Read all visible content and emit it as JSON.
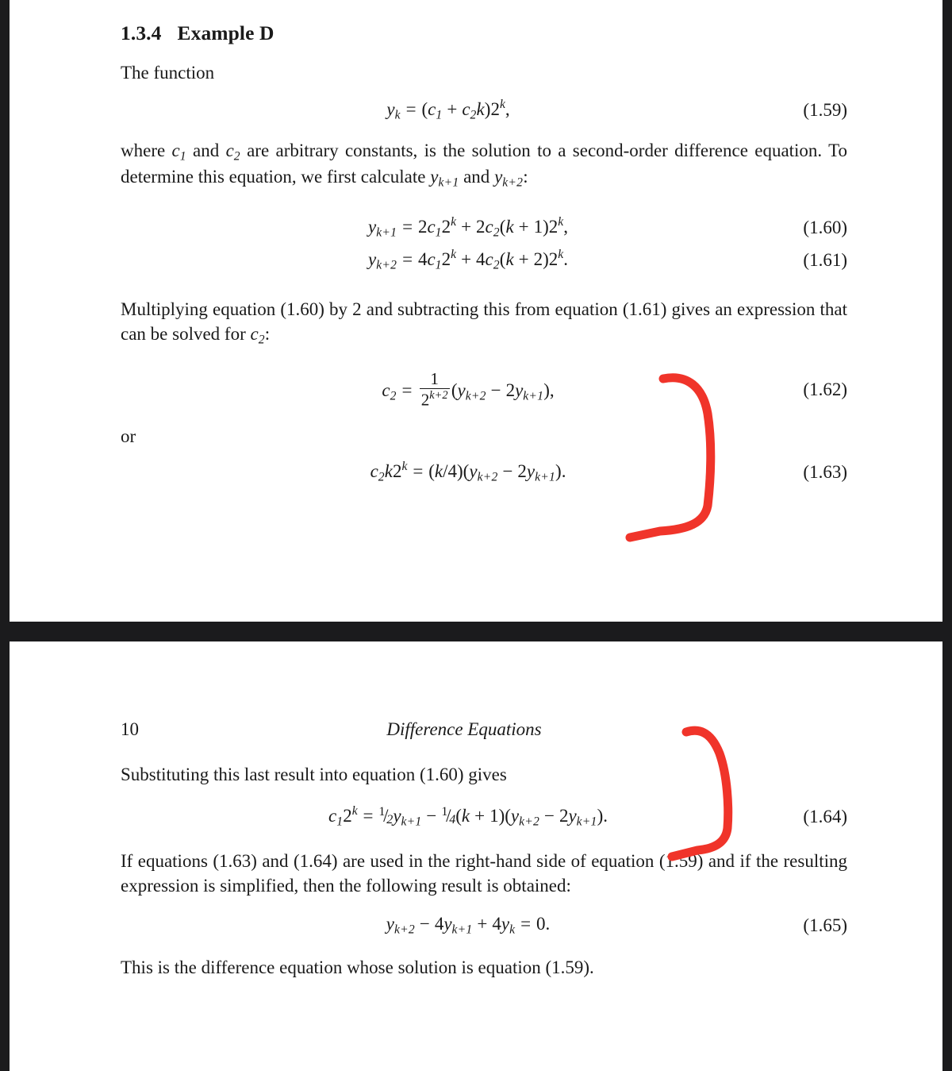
{
  "document": {
    "background_color": "#1b1b1d",
    "page_color": "#ffffff",
    "annotation_color": "#f0342a"
  },
  "page_top": {
    "heading": {
      "number": "1.3.4",
      "title": "Example D"
    },
    "intro": "The function",
    "equation_1_59": {
      "lhs_var": "y",
      "lhs_sub": "k",
      "eq": "=",
      "open": "(",
      "c1": "c",
      "c1_sub": "1",
      "plus": "+",
      "c2": "c",
      "c2_sub": "2",
      "k": "k",
      "close": ")",
      "two": "2",
      "exp": "k",
      "comma": ",",
      "number": "(1.59)"
    },
    "paragraph_1": {
      "part1": "where ",
      "c1": "c",
      "c1_sub": "1",
      "part2": " and ",
      "c2": "c",
      "c2_sub": "2",
      "part3": " are arbitrary constants, is the solution to a second-order difference equation. To determine this equation, we first calculate ",
      "y1": "y",
      "y1_sub": "k+1",
      "part4": " and ",
      "y2": "y",
      "y2_sub": "k+2",
      "part5": ":"
    },
    "equation_1_60": {
      "lhs": "y",
      "lhs_sub": "k+1",
      "eq": "=",
      "t1_coef": "2",
      "t1_c": "c",
      "t1_c_sub": "1",
      "t1_two": "2",
      "t1_exp": "k",
      "plus": "+",
      "t2_coef": "2",
      "t2_c": "c",
      "t2_c_sub": "2",
      "t2_open": "(",
      "t2_k": "k",
      "t2_plus": "+",
      "t2_one": "1",
      "t2_close": ")",
      "t2_two": "2",
      "t2_exp": "k",
      "end": ",",
      "number": "(1.60)"
    },
    "equation_1_61": {
      "lhs": "y",
      "lhs_sub": "k+2",
      "eq": "=",
      "t1_coef": "4",
      "t1_c": "c",
      "t1_c_sub": "1",
      "t1_two": "2",
      "t1_exp": "k",
      "plus": "+",
      "t2_coef": "4",
      "t2_c": "c",
      "t2_c_sub": "2",
      "t2_open": "(",
      "t2_k": "k",
      "t2_plus": "+",
      "t2_one": "2",
      "t2_close": ")",
      "t2_two": "2",
      "t2_exp": "k",
      "end": ".",
      "number": "(1.61)"
    },
    "paragraph_2": {
      "part1": "Multiplying equation (1.60) by 2 and subtracting this from equation (1.61) gives an expression that can be solved for ",
      "c2": "c",
      "c2_sub": "2",
      "part2": ":"
    },
    "equation_1_62": {
      "lhs": "c",
      "lhs_sub": "2",
      "eq": "=",
      "frac_num": "1",
      "frac_den_base": "2",
      "frac_den_exp": "k+2",
      "open": "(",
      "y1": "y",
      "y1_sub": "k+2",
      "minus": "−",
      "coef": "2",
      "y2": "y",
      "y2_sub": "k+1",
      "close": ")",
      "end": ",",
      "number": "(1.62)"
    },
    "or_label": "or",
    "equation_1_63": {
      "c": "c",
      "c_sub": "2",
      "k": "k",
      "two": "2",
      "exp": "k",
      "eq": "=",
      "g_open": "(",
      "g_k": "k",
      "g_slash": "/",
      "g_four": "4",
      "g_close": ")",
      "open": "(",
      "y1": "y",
      "y1_sub": "k+2",
      "minus": "−",
      "coef": "2",
      "y2": "y",
      "y2_sub": "k+1",
      "close": ")",
      "end": ".",
      "number": "(1.63)"
    },
    "annotation": {
      "name": "red-bracket-annotation",
      "shape": "hand-drawn closing bracket"
    }
  },
  "page_bottom": {
    "running_head": {
      "folio": "10",
      "title": "Difference Equations"
    },
    "lead_in": "Substituting this last result into equation (1.60) gives",
    "equation_1_64": {
      "c": "c",
      "c_sub": "1",
      "two": "2",
      "exp": "k",
      "eq": "=",
      "f1_num": "1",
      "f1_slash": "/",
      "f1_den": "2",
      "y1": "y",
      "y1_sub": "k+1",
      "minus": "−",
      "f2_num": "1",
      "f2_slash": "/",
      "f2_den": "4",
      "g_open": "(",
      "g_k": "k",
      "g_plus": "+",
      "g_one": "1",
      "g_close": ")",
      "open": "(",
      "y2": "y",
      "y2_sub": "k+2",
      "minus2": "−",
      "coef": "2",
      "y3": "y",
      "y3_sub": "k+1",
      "close": ")",
      "end": ".",
      "number": "(1.64)"
    },
    "paragraph_1": "If equations (1.63) and (1.64) are used in the right-hand side of equation (1.59) and if the resulting expression is simplified, then the following result is obtained:",
    "equation_1_65": {
      "y1": "y",
      "y1_sub": "k+2",
      "minus": "−",
      "coef1": "4",
      "y2": "y",
      "y2_sub": "k+1",
      "plus": "+",
      "coef2": "4",
      "y3": "y",
      "y3_sub": "k",
      "eq": "=",
      "zero": "0",
      "end": ".",
      "number": "(1.65)"
    },
    "closing": "This is the difference equation whose solution is equation (1.59).",
    "annotation": {
      "name": "red-bracket-annotation",
      "shape": "hand-drawn closing bracket"
    }
  }
}
